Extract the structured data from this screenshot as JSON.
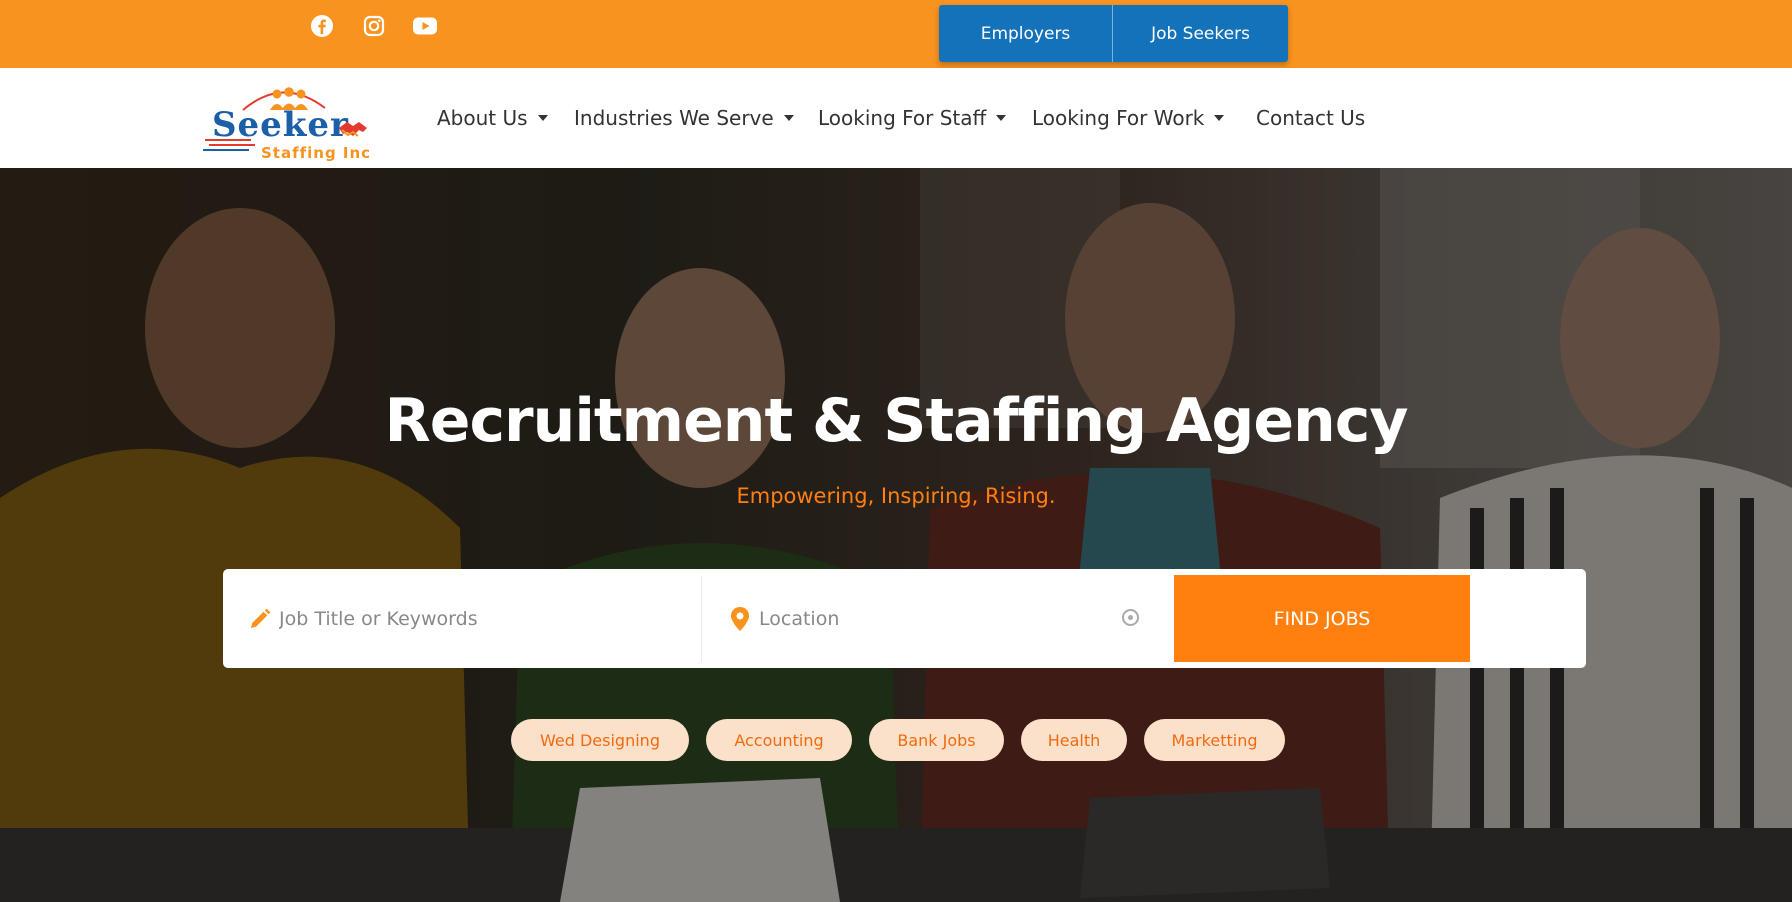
{
  "colors": {
    "topbar": "#F7931E",
    "button_blue": "#1472BA",
    "accent_orange": "#FF7F0F",
    "tag_bg": "#FCE1CA",
    "tag_text": "#F26A0E"
  },
  "social": [
    {
      "name": "facebook",
      "icon": "facebook-icon"
    },
    {
      "name": "instagram",
      "icon": "instagram-icon"
    },
    {
      "name": "youtube",
      "icon": "youtube-icon"
    }
  ],
  "top_buttons": {
    "employers": "Employers",
    "job_seekers": "Job Seekers"
  },
  "logo": {
    "main": "Seeker",
    "sub": "Staffing Inc"
  },
  "nav": [
    {
      "label": "About Us",
      "has_dropdown": true
    },
    {
      "label": "Industries We Serve",
      "has_dropdown": true
    },
    {
      "label": "Looking For Staff",
      "has_dropdown": true
    },
    {
      "label": "Looking For Work",
      "has_dropdown": true
    },
    {
      "label": "Contact Us",
      "has_dropdown": false
    }
  ],
  "hero": {
    "title": "Recruitment & Staffing Agency",
    "subtitle": "Empowering, Inspiring, Rising."
  },
  "search": {
    "keywords_placeholder": "Job Title or Keywords",
    "location_placeholder": "Location",
    "button_label": "FIND JOBS"
  },
  "tags": [
    "Wed Designing",
    "Accounting",
    "Bank Jobs",
    "Health",
    "Marketting"
  ]
}
